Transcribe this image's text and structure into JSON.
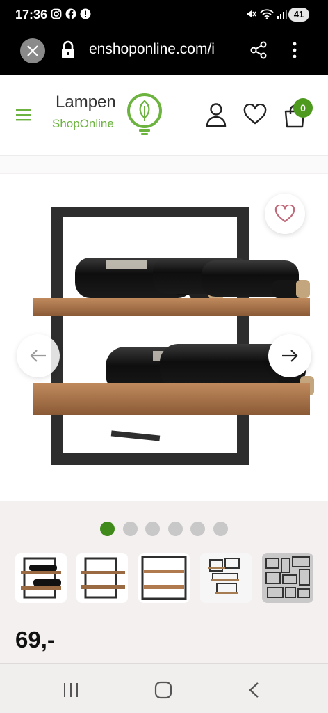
{
  "status_bar": {
    "time": "17:36",
    "battery_level": "41",
    "icons": [
      "instagram-icon",
      "facebook-icon",
      "alert-icon",
      "mute-icon",
      "wifi-icon",
      "signal-icon"
    ]
  },
  "browser": {
    "url": "enshoponline.com/i",
    "icons": [
      "close-icon",
      "lock-icon",
      "share-icon",
      "more-vert-icon"
    ]
  },
  "header": {
    "logo_line1": "Lampen",
    "logo_line2": "ShopOnline",
    "cart_count": "0",
    "brand_color": "#6cb33f",
    "badge_color": "#4d9a1f",
    "icons": [
      "hamburger-menu-icon",
      "user-icon",
      "heart-icon",
      "shopping-bag-icon"
    ]
  },
  "gallery": {
    "image": "wall-mounted-wine-rack-product-photo",
    "slide_count": 6,
    "active_slide": 1,
    "icons": [
      "heart-outline-icon",
      "arrow-left-icon",
      "arrow-right-icon"
    ]
  },
  "thumbnails": [
    {
      "name": "rack-side-view"
    },
    {
      "name": "rack-empty-side-view"
    },
    {
      "name": "rack-front-view"
    },
    {
      "name": "wall-display-room"
    },
    {
      "name": "wall-display-grid",
      "selected": true
    }
  ],
  "product": {
    "price": "69,-"
  },
  "navbar": {
    "icons": [
      "recent-apps-icon",
      "home-icon",
      "back-icon"
    ]
  }
}
